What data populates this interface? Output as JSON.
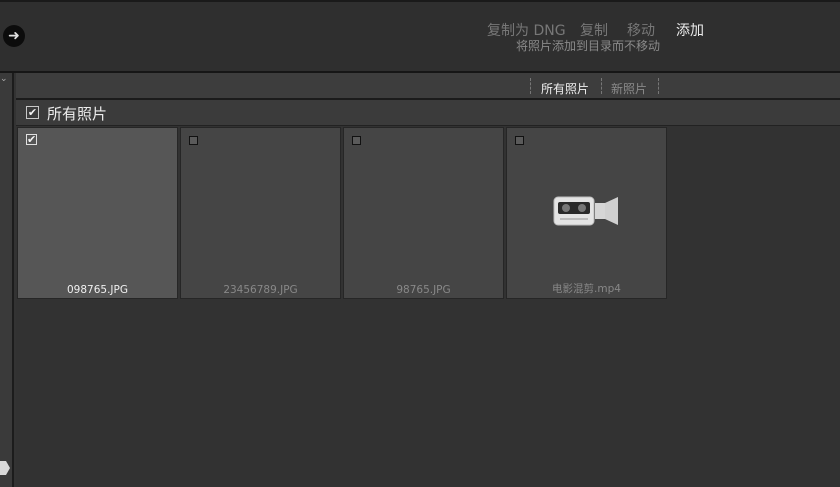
{
  "header": {
    "nav_arrow": "➜",
    "modes": [
      {
        "label": "复制为 DNG",
        "active": false
      },
      {
        "label": "复制",
        "active": false
      },
      {
        "label": "移动",
        "active": false
      },
      {
        "label": "添加",
        "active": true
      }
    ],
    "mode_description": "将照片添加到目录而不移动"
  },
  "tabs": [
    {
      "label": "所有照片",
      "active": true
    },
    {
      "label": "新照片",
      "active": false
    }
  ],
  "group": {
    "title": "所有照片",
    "checked": true
  },
  "grid": {
    "items": [
      {
        "filename": "098765.JPG",
        "checked": true,
        "icon": "none"
      },
      {
        "filename": "23456789.JPG",
        "checked": false,
        "icon": "none"
      },
      {
        "filename": "98765.JPG",
        "checked": false,
        "icon": "none"
      },
      {
        "filename": "电影混剪.mp4",
        "checked": false,
        "icon": "video-camera-icon"
      }
    ]
  },
  "colors": {
    "background": "#333333",
    "selected_cell": "#565656",
    "unselected_cell": "#454545",
    "active_text": "#ececec",
    "inactive_text": "#777777"
  }
}
